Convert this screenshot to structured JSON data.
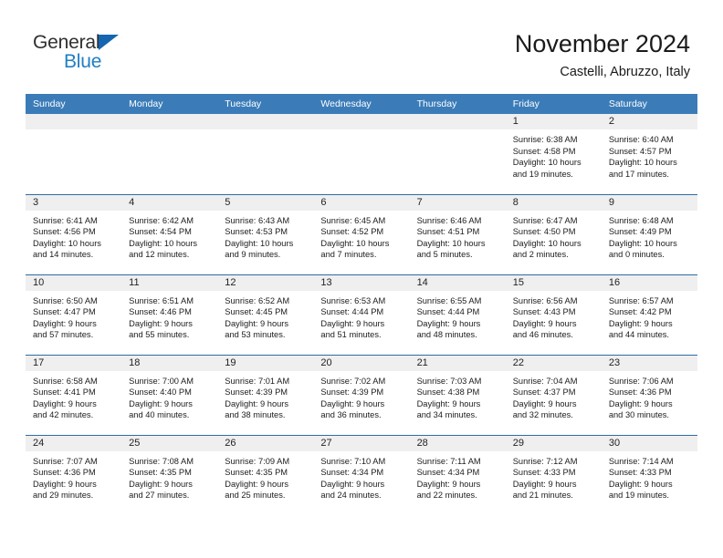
{
  "brand": {
    "name_part1": "General",
    "name_part2": "Blue",
    "triangle_color": "#1565b0",
    "text_color_part1": "#2f2f2f",
    "text_color_part2": "#1f7ec4"
  },
  "header": {
    "title": "November 2024",
    "subtitle": "Castelli, Abruzzo, Italy"
  },
  "colors": {
    "header_blue": "#3b7cb8",
    "row_divider_blue": "#2e6da4",
    "daynum_band": "#efefef",
    "text": "#1c1c1c",
    "page_background": "#ffffff"
  },
  "weekday_headers": [
    "Sunday",
    "Monday",
    "Tuesday",
    "Wednesday",
    "Thursday",
    "Friday",
    "Saturday"
  ],
  "labels": {
    "sunrise_prefix": "Sunrise:",
    "sunset_prefix": "Sunset:",
    "daylight_prefix": "Daylight:"
  },
  "weeks": [
    [
      {
        "day": "",
        "lines": []
      },
      {
        "day": "",
        "lines": []
      },
      {
        "day": "",
        "lines": []
      },
      {
        "day": "",
        "lines": []
      },
      {
        "day": "",
        "lines": []
      },
      {
        "day": "1",
        "lines": [
          "Sunrise: 6:38 AM",
          "Sunset: 4:58 PM",
          "Daylight: 10 hours",
          "and 19 minutes."
        ]
      },
      {
        "day": "2",
        "lines": [
          "Sunrise: 6:40 AM",
          "Sunset: 4:57 PM",
          "Daylight: 10 hours",
          "and 17 minutes."
        ]
      }
    ],
    [
      {
        "day": "3",
        "lines": [
          "Sunrise: 6:41 AM",
          "Sunset: 4:56 PM",
          "Daylight: 10 hours",
          "and 14 minutes."
        ]
      },
      {
        "day": "4",
        "lines": [
          "Sunrise: 6:42 AM",
          "Sunset: 4:54 PM",
          "Daylight: 10 hours",
          "and 12 minutes."
        ]
      },
      {
        "day": "5",
        "lines": [
          "Sunrise: 6:43 AM",
          "Sunset: 4:53 PM",
          "Daylight: 10 hours",
          "and 9 minutes."
        ]
      },
      {
        "day": "6",
        "lines": [
          "Sunrise: 6:45 AM",
          "Sunset: 4:52 PM",
          "Daylight: 10 hours",
          "and 7 minutes."
        ]
      },
      {
        "day": "7",
        "lines": [
          "Sunrise: 6:46 AM",
          "Sunset: 4:51 PM",
          "Daylight: 10 hours",
          "and 5 minutes."
        ]
      },
      {
        "day": "8",
        "lines": [
          "Sunrise: 6:47 AM",
          "Sunset: 4:50 PM",
          "Daylight: 10 hours",
          "and 2 minutes."
        ]
      },
      {
        "day": "9",
        "lines": [
          "Sunrise: 6:48 AM",
          "Sunset: 4:49 PM",
          "Daylight: 10 hours",
          "and 0 minutes."
        ]
      }
    ],
    [
      {
        "day": "10",
        "lines": [
          "Sunrise: 6:50 AM",
          "Sunset: 4:47 PM",
          "Daylight: 9 hours",
          "and 57 minutes."
        ]
      },
      {
        "day": "11",
        "lines": [
          "Sunrise: 6:51 AM",
          "Sunset: 4:46 PM",
          "Daylight: 9 hours",
          "and 55 minutes."
        ]
      },
      {
        "day": "12",
        "lines": [
          "Sunrise: 6:52 AM",
          "Sunset: 4:45 PM",
          "Daylight: 9 hours",
          "and 53 minutes."
        ]
      },
      {
        "day": "13",
        "lines": [
          "Sunrise: 6:53 AM",
          "Sunset: 4:44 PM",
          "Daylight: 9 hours",
          "and 51 minutes."
        ]
      },
      {
        "day": "14",
        "lines": [
          "Sunrise: 6:55 AM",
          "Sunset: 4:44 PM",
          "Daylight: 9 hours",
          "and 48 minutes."
        ]
      },
      {
        "day": "15",
        "lines": [
          "Sunrise: 6:56 AM",
          "Sunset: 4:43 PM",
          "Daylight: 9 hours",
          "and 46 minutes."
        ]
      },
      {
        "day": "16",
        "lines": [
          "Sunrise: 6:57 AM",
          "Sunset: 4:42 PM",
          "Daylight: 9 hours",
          "and 44 minutes."
        ]
      }
    ],
    [
      {
        "day": "17",
        "lines": [
          "Sunrise: 6:58 AM",
          "Sunset: 4:41 PM",
          "Daylight: 9 hours",
          "and 42 minutes."
        ]
      },
      {
        "day": "18",
        "lines": [
          "Sunrise: 7:00 AM",
          "Sunset: 4:40 PM",
          "Daylight: 9 hours",
          "and 40 minutes."
        ]
      },
      {
        "day": "19",
        "lines": [
          "Sunrise: 7:01 AM",
          "Sunset: 4:39 PM",
          "Daylight: 9 hours",
          "and 38 minutes."
        ]
      },
      {
        "day": "20",
        "lines": [
          "Sunrise: 7:02 AM",
          "Sunset: 4:39 PM",
          "Daylight: 9 hours",
          "and 36 minutes."
        ]
      },
      {
        "day": "21",
        "lines": [
          "Sunrise: 7:03 AM",
          "Sunset: 4:38 PM",
          "Daylight: 9 hours",
          "and 34 minutes."
        ]
      },
      {
        "day": "22",
        "lines": [
          "Sunrise: 7:04 AM",
          "Sunset: 4:37 PM",
          "Daylight: 9 hours",
          "and 32 minutes."
        ]
      },
      {
        "day": "23",
        "lines": [
          "Sunrise: 7:06 AM",
          "Sunset: 4:36 PM",
          "Daylight: 9 hours",
          "and 30 minutes."
        ]
      }
    ],
    [
      {
        "day": "24",
        "lines": [
          "Sunrise: 7:07 AM",
          "Sunset: 4:36 PM",
          "Daylight: 9 hours",
          "and 29 minutes."
        ]
      },
      {
        "day": "25",
        "lines": [
          "Sunrise: 7:08 AM",
          "Sunset: 4:35 PM",
          "Daylight: 9 hours",
          "and 27 minutes."
        ]
      },
      {
        "day": "26",
        "lines": [
          "Sunrise: 7:09 AM",
          "Sunset: 4:35 PM",
          "Daylight: 9 hours",
          "and 25 minutes."
        ]
      },
      {
        "day": "27",
        "lines": [
          "Sunrise: 7:10 AM",
          "Sunset: 4:34 PM",
          "Daylight: 9 hours",
          "and 24 minutes."
        ]
      },
      {
        "day": "28",
        "lines": [
          "Sunrise: 7:11 AM",
          "Sunset: 4:34 PM",
          "Daylight: 9 hours",
          "and 22 minutes."
        ]
      },
      {
        "day": "29",
        "lines": [
          "Sunrise: 7:12 AM",
          "Sunset: 4:33 PM",
          "Daylight: 9 hours",
          "and 21 minutes."
        ]
      },
      {
        "day": "30",
        "lines": [
          "Sunrise: 7:14 AM",
          "Sunset: 4:33 PM",
          "Daylight: 9 hours",
          "and 19 minutes."
        ]
      }
    ]
  ]
}
